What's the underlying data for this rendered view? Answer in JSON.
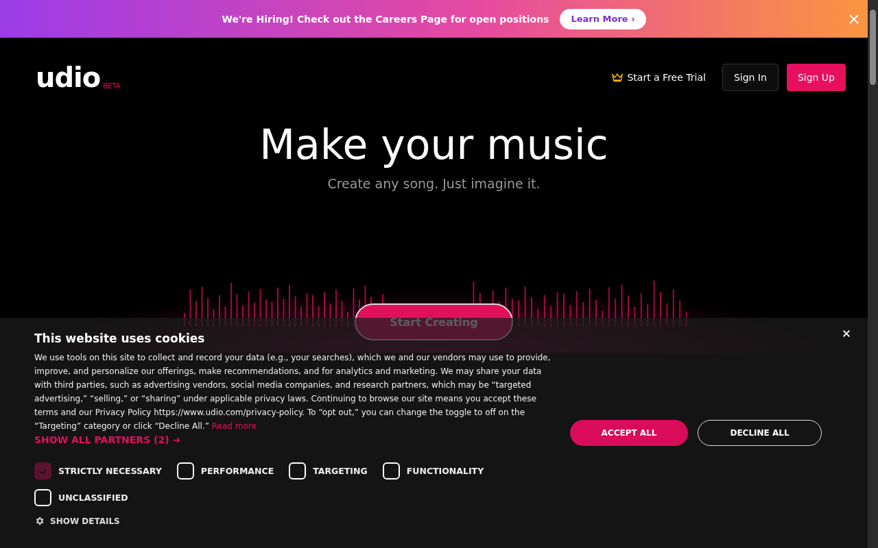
{
  "banner": {
    "text": "We're Hiring! Check out the Careers Page for open positions",
    "button": "Learn More ›"
  },
  "header": {
    "logo": "udio",
    "badge": "BETA",
    "trial": "Start a Free Trial",
    "sign_in": "Sign In",
    "sign_up": "Sign Up"
  },
  "hero": {
    "title": "Make your music",
    "subtitle": "Create any song. Just imagine it.",
    "button": "Start Creating"
  },
  "cookies": {
    "title": "This website uses cookies",
    "body": "We use tools on this site to collect and record your data (e.g., your searches), which we and our vendors may use to provide, improve, and personalize our offerings, make recommendations, and for analytics and marketing. We may share your data with third parties, such as advertising vendors, social media companies, and research partners, which may be “targeted advertising,” “selling,” or “sharing” under applicable privacy laws. Continuing to browse our site means you accept these terms and our Privacy Policy https://www.udio.com/privacy-policy. To “opt out,” you can change the toggle to off on the “Targeting” category or click “Decline All.”",
    "read_more": "Read more",
    "partners": "SHOW ALL PARTNERS (2) ➔",
    "categories": [
      {
        "label": "STRICTLY NECESSARY",
        "checked": true,
        "disabled": true
      },
      {
        "label": "PERFORMANCE",
        "checked": false,
        "disabled": false
      },
      {
        "label": "TARGETING",
        "checked": false,
        "disabled": false
      },
      {
        "label": "FUNCTIONALITY",
        "checked": false,
        "disabled": false
      },
      {
        "label": "UNCLASSIFIED",
        "checked": false,
        "disabled": false
      }
    ],
    "details": "SHOW DETAILS",
    "accept": "ACCEPT ALL",
    "decline": "DECLINE ALL"
  }
}
